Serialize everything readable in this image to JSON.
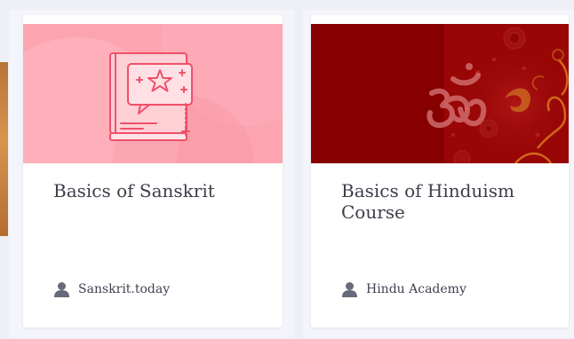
{
  "cards": [
    {
      "title": "Basics of Sanskrit",
      "author": "Sanskrit.today",
      "banner_color": "#fca4b0",
      "banner_icon": "book-star-icon"
    },
    {
      "title": "Basics of Hinduism Course",
      "author": "Hindu Academy",
      "banner_color": "#870000",
      "banner_icon": "om-symbol-icon"
    }
  ],
  "icons": {
    "author": "user-icon"
  }
}
